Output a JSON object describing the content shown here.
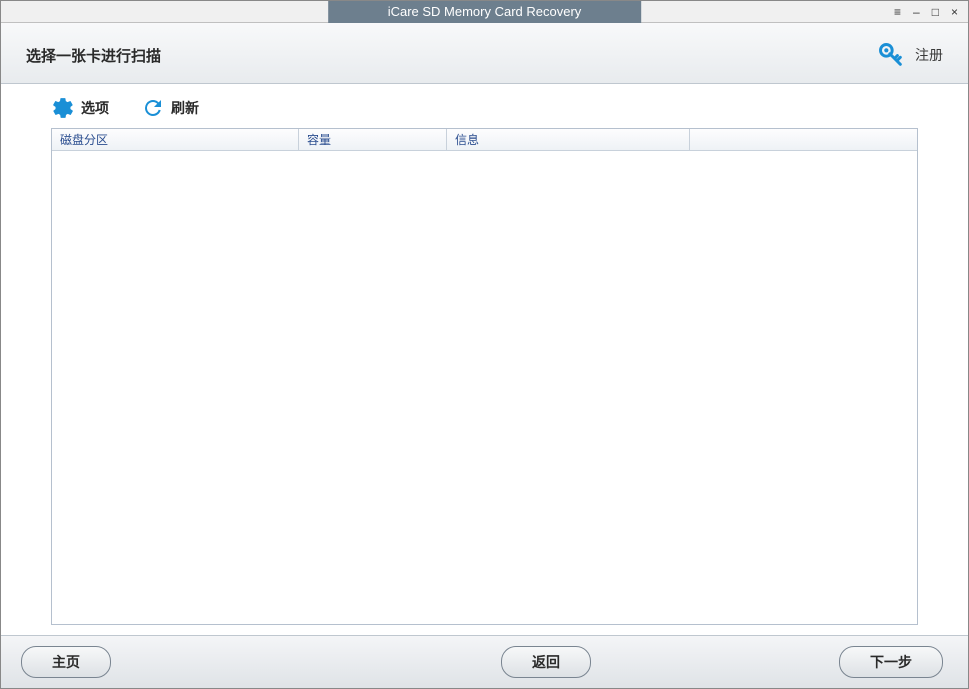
{
  "titlebar": {
    "title": "iCare SD Memory Card Recovery"
  },
  "header": {
    "instruction": "选择一张卡进行扫描",
    "register": "注册"
  },
  "toolbar": {
    "options": "选项",
    "refresh": "刷新"
  },
  "table": {
    "col_partition": "磁盘分区",
    "col_capacity": "容量",
    "col_info": "信息"
  },
  "footer": {
    "home": "主页",
    "back": "返回",
    "next": "下一步"
  }
}
